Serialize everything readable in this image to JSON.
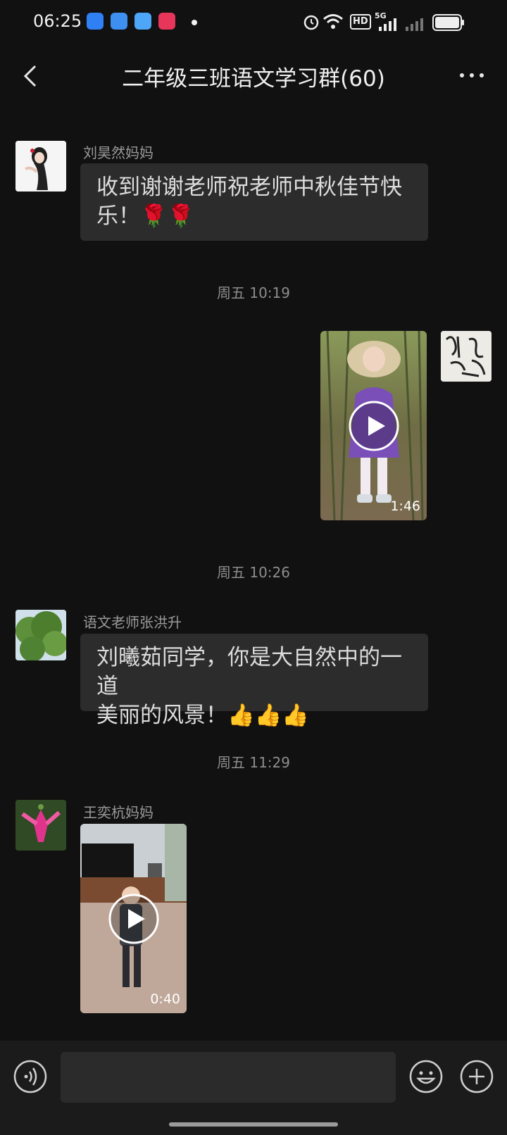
{
  "status_bar": {
    "time": "06:25",
    "app_icons": [
      "blue-app-icon",
      "cloud-weather-icon",
      "qq-browser-icon",
      "video-play-icon"
    ],
    "indicators": [
      "alarm-icon",
      "wifi-icon",
      "hd-icon",
      "5g-signal-icon",
      "signal-icon",
      "battery-icon"
    ],
    "hd_label": "HD",
    "network_label": "5G"
  },
  "header": {
    "title": "二年级三班语文学习群(60)"
  },
  "messages": [
    {
      "type": "text",
      "sender": "刘昊然妈妈",
      "text_line1": "收到谢谢老师祝老师中秋佳节快",
      "text_line2": "乐！🌹🌹"
    },
    {
      "type": "timestamp",
      "text": "周五 10:19"
    },
    {
      "type": "video",
      "outgoing": true,
      "duration": "1:46"
    },
    {
      "type": "timestamp",
      "text": "周五 10:26"
    },
    {
      "type": "text",
      "sender": "语文老师张洪升",
      "text_line1": "刘曦茹同学，你是大自然中的一道",
      "text_line2": "美丽的风景！👍👍👍"
    },
    {
      "type": "timestamp",
      "text": "周五 11:29"
    },
    {
      "type": "video",
      "sender": "王奕杭妈妈",
      "duration": "0:40"
    }
  ],
  "input_bar": {
    "placeholder": ""
  },
  "colors": {
    "background": "#111111",
    "bubble": "#2c2c2c",
    "bottom_bar": "#1b1b1b"
  }
}
